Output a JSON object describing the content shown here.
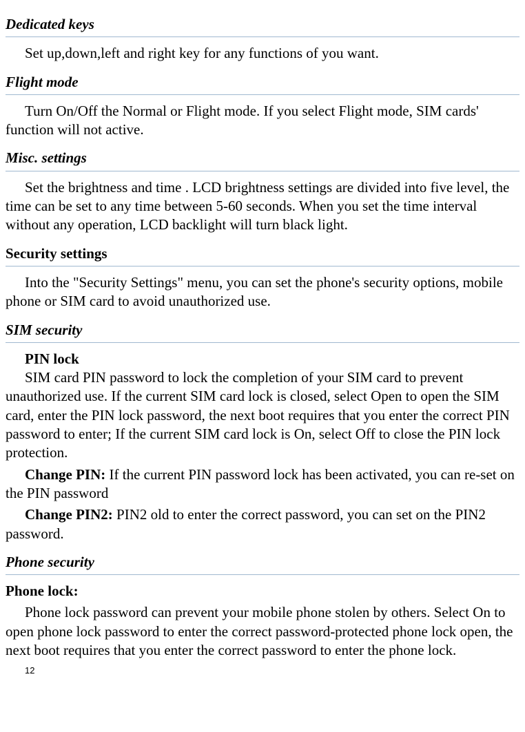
{
  "sections": {
    "dedicated_keys": {
      "heading": "Dedicated keys",
      "body": "Set up,down,left and right key for any functions of you want."
    },
    "flight_mode": {
      "heading": "Flight mode",
      "body": "Turn On/Off the Normal or Flight mode. If you select Flight mode, SIM cards' function will not active."
    },
    "misc_settings": {
      "heading": "Misc. settings",
      "body": "Set the brightness and time . LCD brightness settings are divided into five level, the time can be set to any time between 5-60 seconds. When you set the time interval without any operation, LCD backlight will turn black light."
    },
    "security_settings": {
      "heading": "Security settings",
      "body": "Into the \"Security Settings\" menu, you can set the phone's security options, mobile phone or SIM card to avoid unauthorized use."
    },
    "sim_security": {
      "heading": "SIM security",
      "pin_lock_label": "PIN lock",
      "pin_lock_body": "SIM card PIN password to lock the completion of your SIM card to prevent unauthorized use. If the current SIM card lock is closed, select Open to open the SIM card, enter the PIN lock password, the next boot requires that you enter the correct PIN password to enter; If the current SIM card lock is On, select Off to close the PIN lock protection.",
      "change_pin_label": "Change PIN:",
      "change_pin_body": "    If the current PIN password lock has been activated, you can re-set on the PIN password",
      "change_pin2_label": "Change PIN2:",
      "change_pin2_body": "   PIN2 old to enter the correct password, you can set on the PIN2 password."
    },
    "phone_security": {
      "heading": "Phone security",
      "phone_lock_label": "Phone lock:",
      "phone_lock_body": "Phone lock password can prevent your mobile phone stolen by others. Select On to open phone lock password to enter the correct password-protected phone lock open, the next boot requires that you enter the correct password to enter the phone lock."
    }
  },
  "page_number": "12"
}
